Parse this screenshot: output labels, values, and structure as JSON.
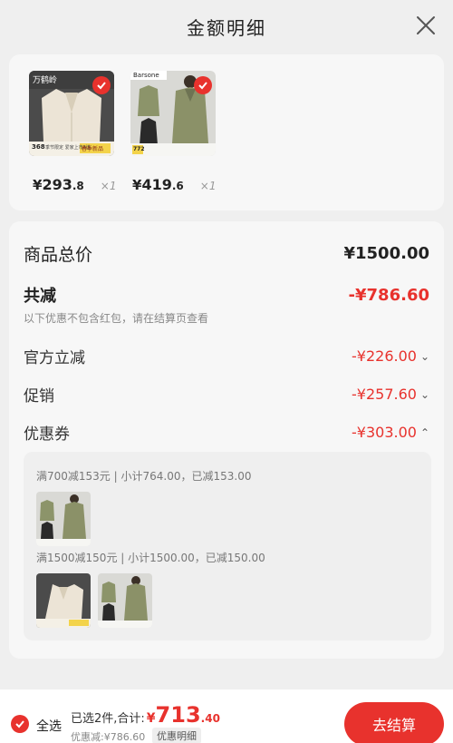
{
  "header": {
    "title": "金额明细"
  },
  "products": [
    {
      "brand": "万鹤岭",
      "badge_price": "368",
      "badge_text": "季节限定 爱家上市3送",
      "badge_tag": "春季新品",
      "price_yen": "¥",
      "price_int": "293",
      "price_dec": ".8",
      "qty": "×1"
    },
    {
      "brand": "Barsone",
      "badge_price": "772",
      "price_yen": "¥",
      "price_int": "419",
      "price_dec": ".6",
      "qty": "×1"
    }
  ],
  "summary": {
    "total_label": "商品总价",
    "total_value": "¥1500.00",
    "discount_label": "共减",
    "discount_value": "-¥786.60",
    "hint": "以下优惠不包含红包，请在结算页查看",
    "official_label": "官方立减",
    "official_value": "-¥226.00",
    "promo_label": "促销",
    "promo_value": "-¥257.60",
    "coupon_label": "优惠券",
    "coupon_value": "-¥303.00"
  },
  "coupons": [
    {
      "text": "满700减153元 | 小计764.00，已减153.00"
    },
    {
      "text": "满1500减150元 | 小计1500.00，已减150.00"
    }
  ],
  "footer": {
    "select_all": "全选",
    "selected_text": "已选2件,合计:",
    "yen": "¥",
    "total_int": "713",
    "total_dec": ".40",
    "saved": "优惠减:¥786.60",
    "detail_tag": "优惠明细",
    "checkout": "去结算"
  },
  "colors": {
    "accent": "#e8322d",
    "background": "#efefef",
    "card": "#f7f7f7"
  }
}
